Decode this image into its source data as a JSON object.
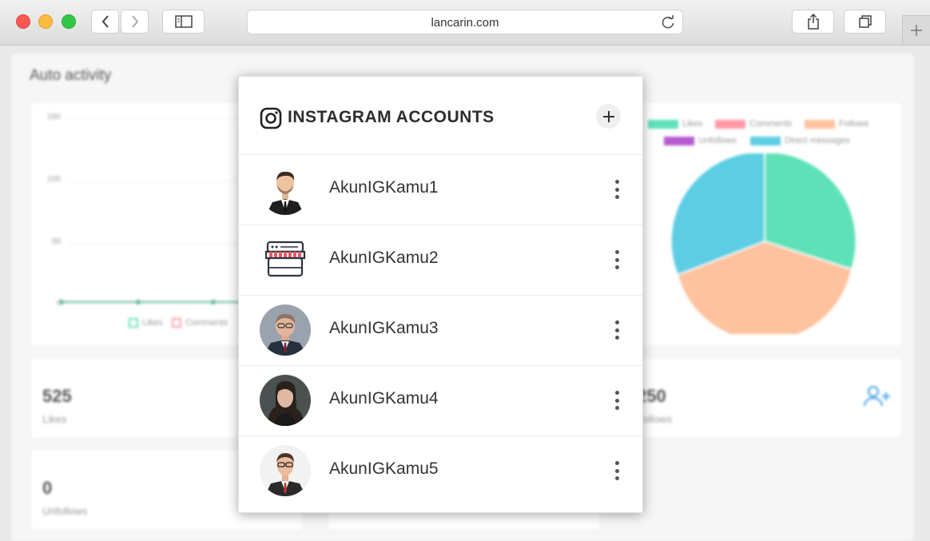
{
  "browser": {
    "url": "lancarin.com"
  },
  "dashboard": {
    "title": "Auto activity",
    "line_chart": {
      "y_ticks": [
        "150",
        "100",
        "50",
        "0"
      ],
      "legend": [
        "Likes",
        "Comments"
      ]
    },
    "pie_legend": [
      {
        "label": "Likes",
        "color": "#5fe1b8"
      },
      {
        "label": "Comments",
        "color": "#ff9aa8"
      },
      {
        "label": "Follows",
        "color": "#ffc29e"
      },
      {
        "label": "Unfollows",
        "color": "#b65ad0"
      },
      {
        "label": "Direct messages",
        "color": "#5dcde3"
      }
    ],
    "stats": [
      {
        "value": "525",
        "label": "Likes"
      },
      {
        "value": "250",
        "label": "Follows"
      },
      {
        "value": "0",
        "label": "Unfollows"
      }
    ]
  },
  "modal": {
    "title": "INSTAGRAM ACCOUNTS",
    "accounts": [
      {
        "name": "AkunIGKamu1"
      },
      {
        "name": "AkunIGKamu2"
      },
      {
        "name": "AkunIGKamu3"
      },
      {
        "name": "AkunIGKamu4"
      },
      {
        "name": "AkunIGKamu5"
      }
    ]
  }
}
